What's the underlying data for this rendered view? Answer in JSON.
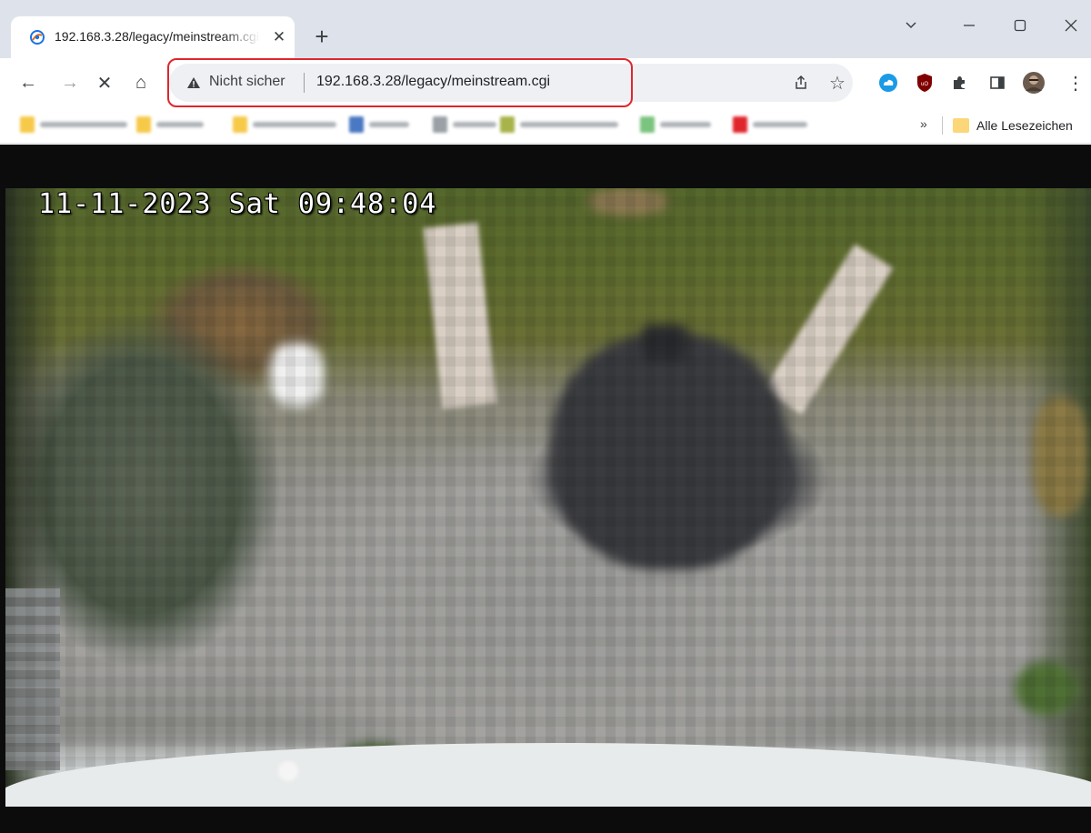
{
  "tab": {
    "title": "192.168.3.28/legacy/meinstream.cgi",
    "favicon": "web-globe-icon",
    "close_glyph": "✕"
  },
  "new_tab_glyph": "+",
  "window_controls": {
    "dropdown_glyph": "⌄",
    "minimize_glyph": "—",
    "maximize_glyph": "▢",
    "close_glyph": "✕"
  },
  "toolbar": {
    "back_glyph": "←",
    "forward_glyph": "→",
    "stop_glyph": "✕",
    "home_glyph": "⌂",
    "security_icon": "warning-triangle-icon",
    "security_label": "Nicht sicher",
    "url": "192.168.3.28/legacy/meinstream.cgi",
    "share_glyph": "⇪",
    "bookmark_glyph": "☆",
    "menu_glyph": "⋮",
    "highlight_color": "#e0262d"
  },
  "bookmarks": {
    "overflow_glyph": "»",
    "all_bookmarks_label": "Alle Lesezeichen"
  },
  "camera": {
    "timestamp": "11-11-2023 Sat 09:48:04"
  }
}
